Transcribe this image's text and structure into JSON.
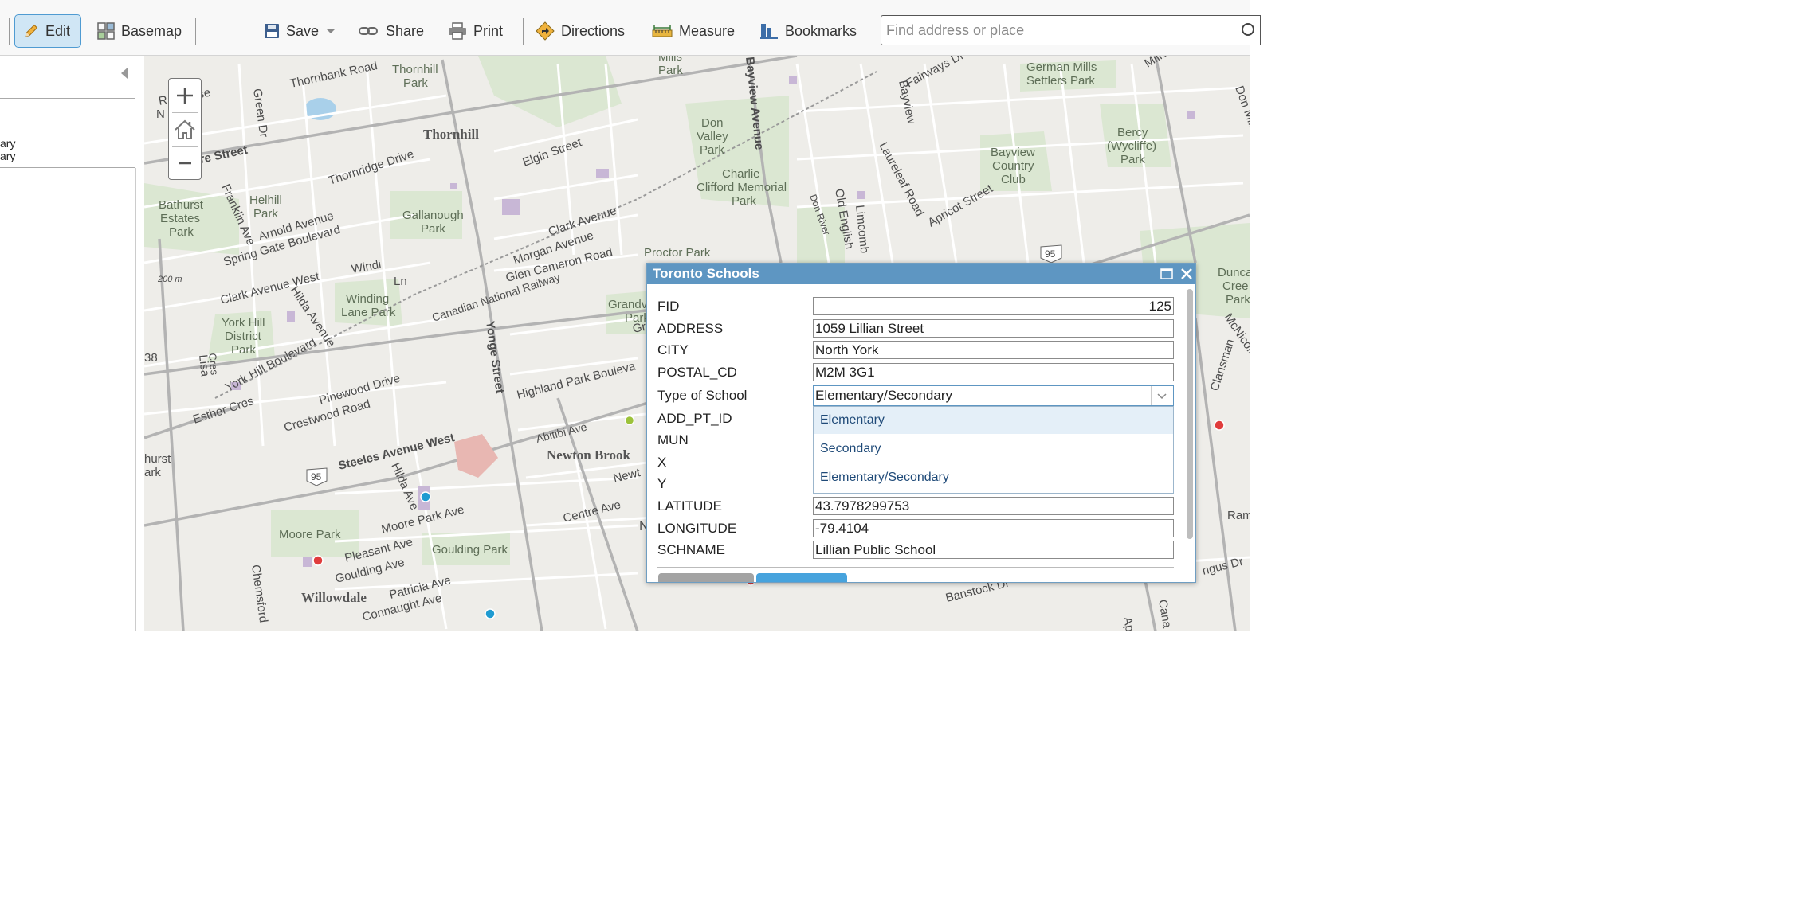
{
  "toolbar": {
    "edit_label": "Edit",
    "basemap_label": "Basemap",
    "save_label": "Save",
    "share_label": "Share",
    "print_label": "Print",
    "directions_label": "Directions",
    "measure_label": "Measure",
    "bookmarks_label": "Bookmarks",
    "search_placeholder": "Find address or place"
  },
  "side_panel": {
    "legend_line1": "ary",
    "legend_line2": "ary"
  },
  "map": {
    "labels": {
      "thornbank_road": "Thornbank Road",
      "thornhill_park": "Thornhill",
      "thornhill_park2": "Park",
      "mills_park": "Mills",
      "mills_park2": "Park",
      "bayview_avenue": "Bayview Avenue",
      "fairways": "Fairways Dr",
      "german_mills": "German Mills",
      "settlers_park": "Settlers Park",
      "mills_road": "Mills Road",
      "don_mills": "Don Mills",
      "rose": "R    le Rose",
      "n_park": "N         ark",
      "green_dr": "Green Dr",
      "thornhill": "Thornhill",
      "don_valley": "Don",
      "don_valley2": "Valley",
      "don_valley3": "Park",
      "bayview_vert": "Bayview",
      "laureleaf": "Laureleaf Road",
      "bayview_country": "Bayview",
      "bayview_country2": "Country",
      "bayview_country3": "Club",
      "bercy": "Bercy",
      "bercy2": "(Wycliffe)",
      "bercy3": "Park",
      "centre_street": "ntre Street",
      "thornridge": "Thornridge Drive",
      "elgin": "Elgin Street",
      "charlie": "Charlie",
      "charlie2": "Clifford Memorial",
      "charlie3": "Park",
      "don_river": "Don River",
      "old_english": "Old English",
      "limcomb": "Limcomb",
      "apricot": "Apricot Street",
      "bathurst": "Bathurst",
      "bathurst2": "Estates",
      "bathurst3": "Park",
      "franklin": "Franklin Ave",
      "hefhill": "Helhill",
      "hefhill2": "Park",
      "arnold": "Arnold Avenue",
      "gallanough": "Gallanough",
      "gallanough2": "Park",
      "clark_ave": "Clark Avenue",
      "spring_gate": "Spring Gate Boulevard",
      "morgan": "Morgan Avenue",
      "glen_cameron": "Glen Cameron Road",
      "proctor": "Proctor Park",
      "hwy95_right": "95",
      "duncan": "Dunca",
      "duncan2": "Cree",
      "duncan3": "Park",
      "elev": "200 m",
      "windi": "Windi",
      "ln": "Ln",
      "clark_west": "Clark Avenue West",
      "cn_railway": "Canadian National Railway",
      "winding": "Winding",
      "winding2": "Lane Park",
      "hilda_avenue": "Hilda Avenue",
      "grandview": "Grandview",
      "grandview2": "Park",
      "grand3": "Grand",
      "york_hill": "York Hill",
      "york_hill2": "District",
      "york_hill3": "Park",
      "yonge": "Yonge Street",
      "mcnicoll": "McNicoll",
      "clansman": "Clansman",
      "hwy38": "38",
      "lisa": "Lisa",
      "cres": "Cres",
      "york_hill_blvd": "York Hill Boulevard",
      "pinewood": "Pinewood Drive",
      "highland": "Highland Park Bouleva",
      "esther": "Esther Cres",
      "crestwood": "Crestwood Road",
      "abitibi": "Abitibi Ave",
      "steeles": "Steeles Avenue West",
      "newton_brook": "Newton Brook",
      "hurst": "hurst",
      "hurst2": "ark",
      "hwy95": "95",
      "hilda_ave": "Hilda Ave",
      "newt": "Newt",
      "moore_park_ave": "Moore Park Ave",
      "centre_ave": "Centre Ave",
      "moore_park": "Moore Park",
      "pleasant": "Pleasant Ave",
      "goulding_park": "Goulding Park",
      "goulding_ave": "Goulding Ave",
      "chemsford": "Chemsford",
      "willowdale": "Willowdale",
      "patricia": "Patricia Ave",
      "connaught": "Connaught Ave",
      "banstock": "Banstock Dr",
      "ngus": "ngus Dr",
      "ram": "Ram",
      "n_letter": "N",
      "ap": "Ap",
      "cana": "Cana"
    },
    "marker_colors": {
      "selected": "#9cc23a",
      "blue": "#1f9bd1",
      "red": "#e03c3c"
    }
  },
  "popup": {
    "title": "Toronto Schools",
    "fields": {
      "fid": {
        "label": "FID",
        "value": "125"
      },
      "address": {
        "label": "ADDRESS",
        "value": "1059 Lillian Street"
      },
      "city": {
        "label": "CITY",
        "value": "North York"
      },
      "postal": {
        "label": "POSTAL_CD",
        "value": "M2M 3G1"
      },
      "type": {
        "label": "Type of School",
        "value": "Elementary/Secondary"
      },
      "add_pt_id": {
        "label": "ADD_PT_ID"
      },
      "mun": {
        "label": "MUN"
      },
      "x": {
        "label": "X"
      },
      "y": {
        "label": "Y"
      },
      "latitude": {
        "label": "LATITUDE",
        "value": "43.7978299753"
      },
      "longitude": {
        "label": "LONGITUDE",
        "value": "-79.4104"
      },
      "schname": {
        "label": "SCHNAME",
        "value": "Lillian Public School"
      }
    },
    "type_options": [
      "Elementary",
      "Secondary",
      "Elementary/Secondary"
    ]
  }
}
